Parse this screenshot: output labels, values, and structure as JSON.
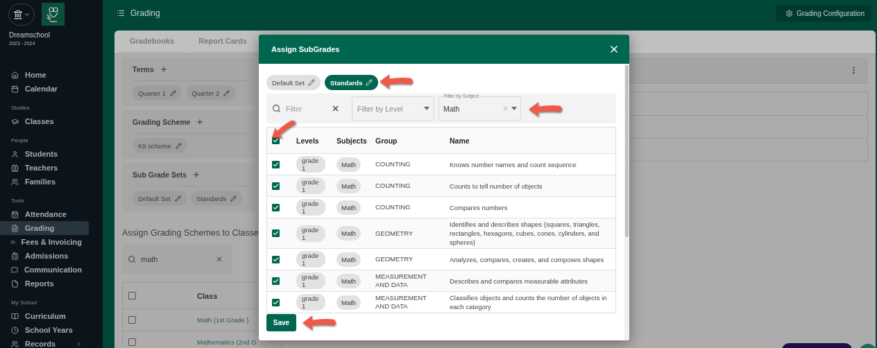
{
  "sidebar": {
    "school": "Dreamschool",
    "years": "2023 - 2024",
    "sections": [
      {
        "items": [
          {
            "label": "Home",
            "selected": false,
            "submenu": false
          },
          {
            "label": "Calendar",
            "selected": false,
            "submenu": false
          }
        ]
      },
      {
        "heading": "Studies",
        "items": [
          {
            "label": "Classes",
            "selected": false,
            "submenu": false
          }
        ]
      },
      {
        "heading": "People",
        "items": [
          {
            "label": "Students",
            "selected": false,
            "submenu": false
          },
          {
            "label": "Teachers",
            "selected": false,
            "submenu": false
          },
          {
            "label": "Families",
            "selected": false,
            "submenu": false
          }
        ]
      },
      {
        "heading": "Tools",
        "items": [
          {
            "label": "Attendance",
            "selected": false,
            "submenu": false
          },
          {
            "label": "Grading",
            "selected": true,
            "submenu": false
          },
          {
            "label": "Fees & Invoicing",
            "selected": false,
            "submenu": false
          },
          {
            "label": "Admissions",
            "selected": false,
            "submenu": false
          },
          {
            "label": "Communication",
            "selected": false,
            "submenu": false
          },
          {
            "label": "Reports",
            "selected": false,
            "submenu": false
          }
        ]
      },
      {
        "heading": "My School",
        "items": [
          {
            "label": "Curriculum",
            "selected": false,
            "submenu": false
          },
          {
            "label": "School Years",
            "selected": false,
            "submenu": false
          },
          {
            "label": "Records",
            "selected": false,
            "submenu": true
          }
        ]
      }
    ]
  },
  "topbar": {
    "title": "Grading",
    "config_button": "Grading Configuration"
  },
  "tabs": [
    {
      "label": "Gradebooks",
      "selected": false
    },
    {
      "label": "Report Cards",
      "selected": false
    }
  ],
  "settings_sections": [
    {
      "title": "Terms",
      "chips": [
        "Quarter 1",
        "Quarter 2"
      ]
    },
    {
      "title": "Grading Scheme",
      "chips": [
        "K9 scheme"
      ]
    },
    {
      "title": "Sub Grade Sets",
      "chips": [
        "Default Set",
        "Standards"
      ]
    }
  ],
  "class_assignment": {
    "title": "Assign Grading Schemes to Classe",
    "search": {
      "value": "math"
    },
    "select_all_checked": false,
    "column": "Class",
    "rows": [
      {
        "checked": false,
        "class": "Math (1st Grade )"
      },
      {
        "checked": false,
        "class": "Mathematics (2nd G"
      }
    ]
  },
  "modal": {
    "title": "Assign SubGrades",
    "sets": [
      {
        "label": "Default Set",
        "selected": false
      },
      {
        "label": "Standards",
        "selected": true
      }
    ],
    "filter": {
      "placeholder": "Filter"
    },
    "level_filter": {
      "placeholder": "Filter by Level"
    },
    "subject_filter": {
      "label": "Filter by Subject",
      "value": "Math"
    },
    "select_all_checked": true,
    "columns": [
      "Levels",
      "Subjects",
      "Group",
      "Name"
    ],
    "rows": [
      {
        "checked": true,
        "level": "grade 1",
        "subject": "Math",
        "group": "COUNTING",
        "name": "Knows number names and count sequence"
      },
      {
        "checked": true,
        "level": "grade 1",
        "subject": "Math",
        "group": "COUNTING",
        "name": "Counts to tell number of objects"
      },
      {
        "checked": true,
        "level": "grade 1",
        "subject": "Math",
        "group": "COUNTING",
        "name": "Compares numbers"
      },
      {
        "checked": true,
        "level": "grade 1",
        "subject": "Math",
        "group": "GEOMETRY",
        "name": "Identifies and describes shapes (squares, triangles, rectangles, hexagons, cubes, cones, cylinders, and spheres)"
      },
      {
        "checked": true,
        "level": "grade 1",
        "subject": "Math",
        "group": "GEOMETRY",
        "name": "Analyzes, compares, creates, and composes shapes"
      },
      {
        "checked": true,
        "level": "grade 1",
        "subject": "Math",
        "group": "MEASUREMENT AND DATA",
        "name": "Describes and compares measurable attributes"
      },
      {
        "checked": true,
        "level": "grade 1",
        "subject": "Math",
        "group": "MEASUREMENT AND DATA",
        "name": "Classifies objects and counts the number of objects in each category"
      }
    ],
    "save_button": "Save"
  }
}
